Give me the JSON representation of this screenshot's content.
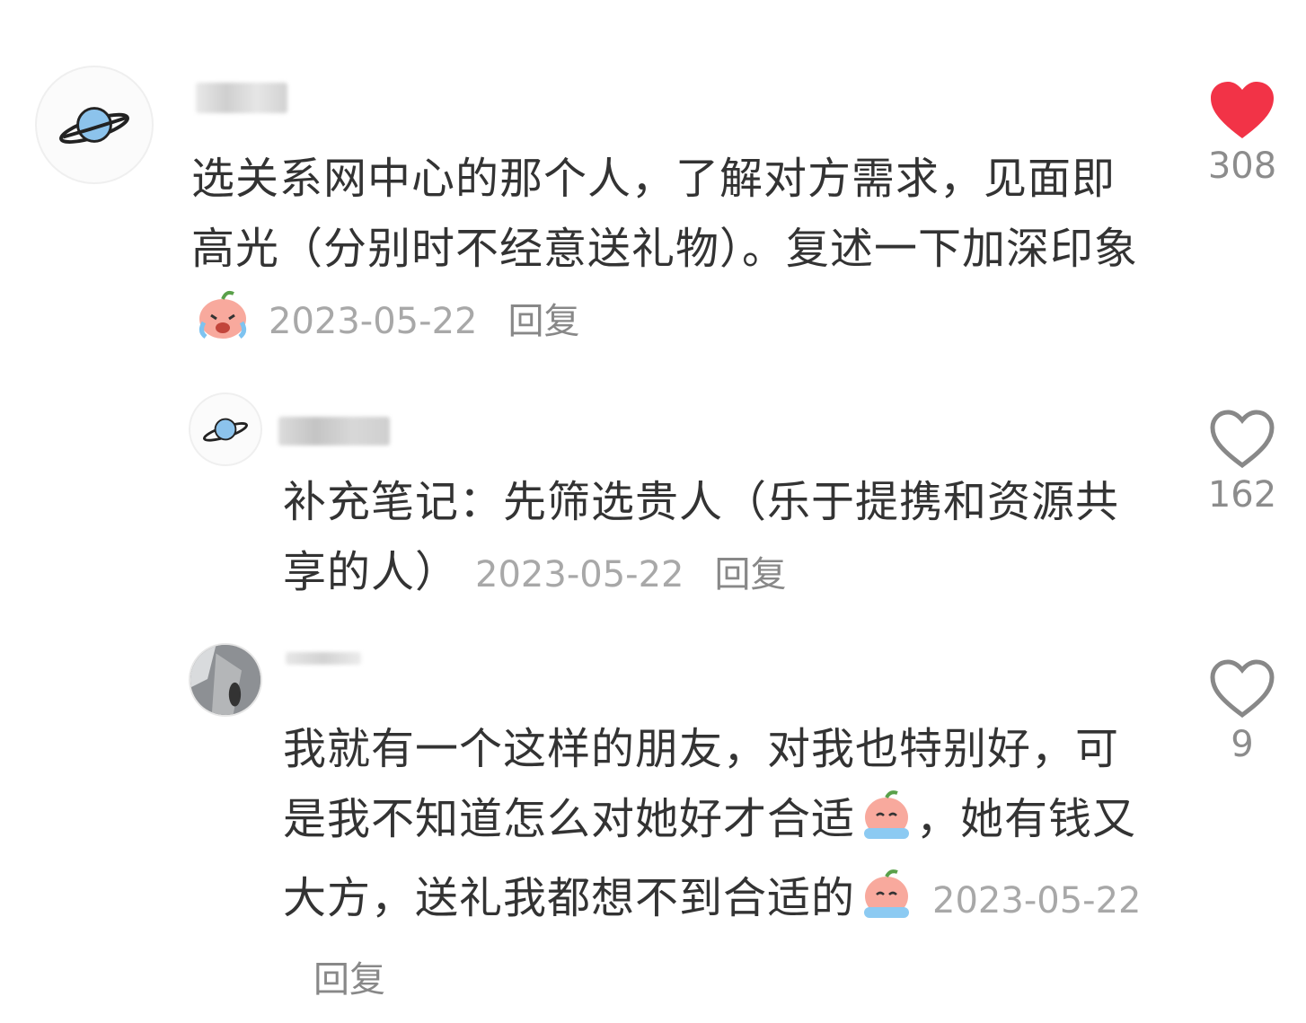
{
  "comments": [
    {
      "content": "选关系网中心的那个人，了解对方需求，见面即高光（分别时不经意送礼物）。复述一下加深印象",
      "date": "2023-05-22",
      "reply_label": "回复",
      "likes": "308",
      "liked": true
    },
    {
      "content": "补充笔记：先筛选贵人（乐于提携和资源共享的人）",
      "date": "2023-05-22",
      "reply_label": "回复",
      "likes": "162",
      "liked": false
    },
    {
      "content_1": "我就有一个这样的朋友，对我也特别好，可是我不知道怎么对她好才合适",
      "content_2": "，她有钱又大方，送礼我都想不到合适的",
      "date": "2023-05-22",
      "reply_label": "回复",
      "likes": "9",
      "liked": false
    }
  ],
  "colors": {
    "like_active": "#f23347",
    "like_inactive": "#888888",
    "meta": "#a8a8a8"
  }
}
